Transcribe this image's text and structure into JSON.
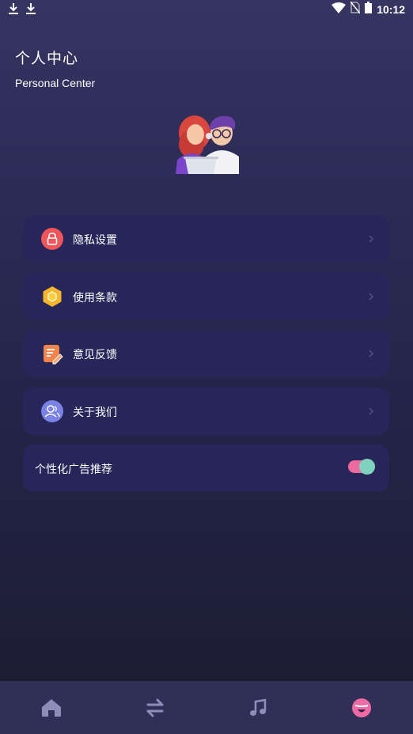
{
  "status_bar": {
    "time": "10:12",
    "left_icons": [
      "download-icon",
      "download-icon"
    ],
    "right_icons": [
      "wifi-icon",
      "no-sim-icon",
      "battery-icon"
    ]
  },
  "header": {
    "title": "个人中心",
    "subtitle": "Personal Center"
  },
  "menu": {
    "items": [
      {
        "label": "隐私设置",
        "icon": "lock-icon",
        "accent": "#f0555a"
      },
      {
        "label": "使用条款",
        "icon": "hexagon-icon",
        "accent": "#f6b62a"
      },
      {
        "label": "意见反馈",
        "icon": "feedback-icon",
        "accent": "#f2834a"
      },
      {
        "label": "关于我们",
        "icon": "users-icon",
        "accent": "#7b82e6"
      }
    ]
  },
  "personalized_ads": {
    "label": "个性化广告推荐",
    "enabled": true
  },
  "bottom_nav": {
    "items": [
      {
        "icon": "home-icon",
        "active": false
      },
      {
        "icon": "swap-icon",
        "active": false
      },
      {
        "icon": "music-icon",
        "active": false
      },
      {
        "icon": "profile-face-icon",
        "active": true
      }
    ]
  },
  "colors": {
    "background_top": "#363461",
    "background_bottom": "#1b1c2f",
    "card": "#27265a",
    "toggle_track": "#ef6a9c",
    "toggle_knob": "#7fd2be",
    "nav_bar": "#302f57",
    "nav_inactive": "#8e8cb8",
    "nav_active": "#f06aa6"
  }
}
